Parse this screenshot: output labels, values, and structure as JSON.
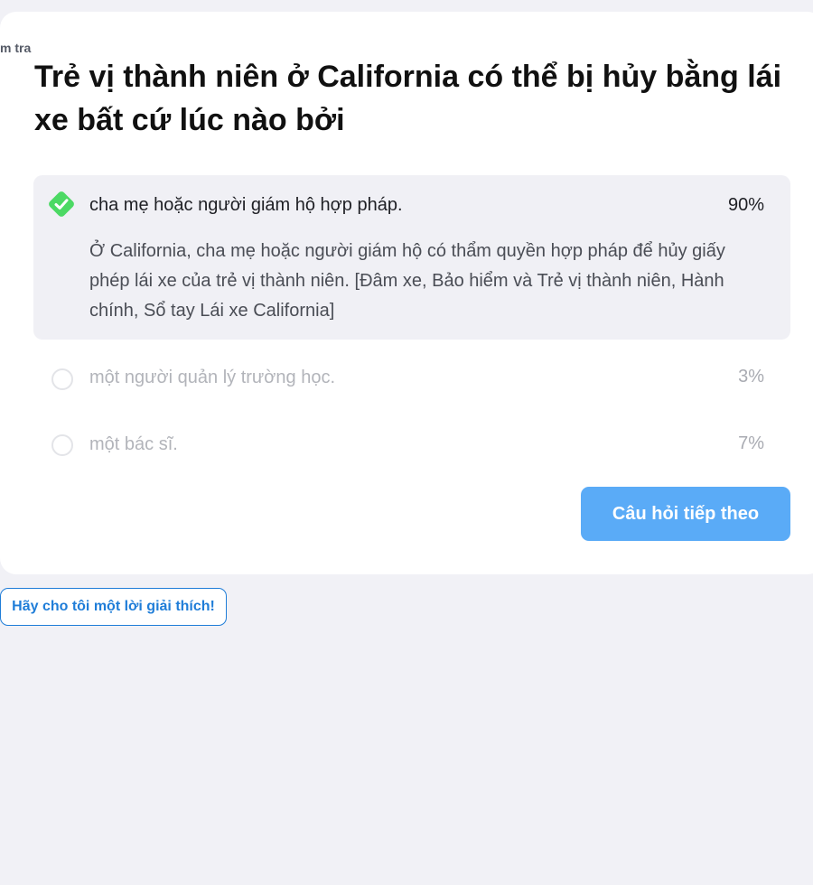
{
  "quiz": {
    "badge": "m tra",
    "question": "Trẻ vị thành niên ở California có thể bị hủy bằng lái xe bất cứ lúc nào bởi",
    "options": [
      {
        "text": "cha mẹ hoặc người giám hộ hợp pháp.",
        "percent": "90%",
        "correct": true,
        "icon": "check-icon",
        "explanation": "Ở California, cha mẹ hoặc người giám hộ có thẩm quyền hợp pháp để hủy giấy phép lái xe của trẻ vị thành niên. [Đâm xe, Bảo hiểm và Trẻ vị thành niên, Hành chính, Sổ tay Lái xe California]"
      },
      {
        "text": "một người quản lý trường học.",
        "percent": "3%",
        "correct": false,
        "icon": "radio-icon"
      },
      {
        "text": "một bác sĩ.",
        "percent": "7%",
        "correct": false,
        "icon": "radio-icon"
      }
    ],
    "next_label": "Câu hỏi tiếp theo"
  },
  "explain_label": "Hãy cho tôi một lời giải thích!",
  "colors": {
    "background": "#f1f1f6",
    "card": "#ffffff",
    "correct_fill": "#f0f0f5",
    "check_green": "#4cd964",
    "next_button": "#5aabf7",
    "link_blue": "#1f7dd8"
  }
}
